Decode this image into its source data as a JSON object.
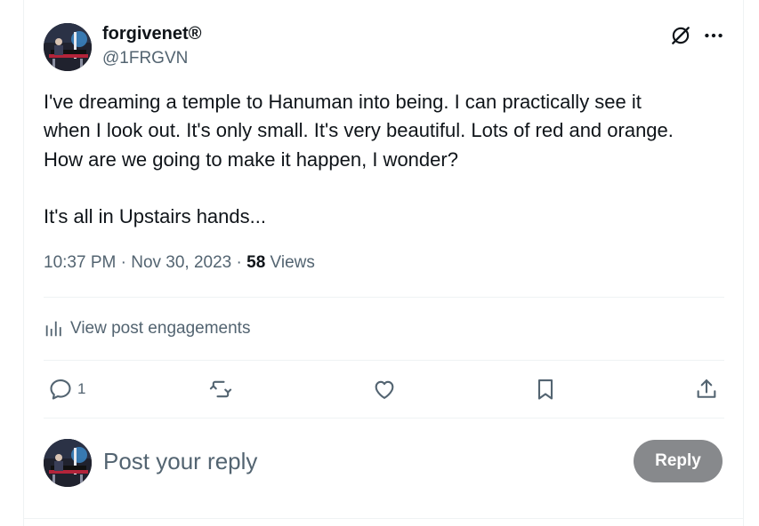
{
  "author": {
    "display_name": "forgivenet",
    "registered_mark": "®",
    "handle": "@1FRGVN",
    "avatar_icon": "avatar-pianist-icon"
  },
  "header_icons": {
    "grok": "grok-icon",
    "more": "more-icon"
  },
  "post": {
    "text": "I've dreaming a temple to Hanuman into being. I can practically see it\nwhen I look out. It's only small. It's very beautiful. Lots of red and orange.\nHow are we going to make it happen, I wonder?\n\nIt's all in Upstairs hands..."
  },
  "meta": {
    "time": "10:37 PM",
    "separator": " · ",
    "date": "Nov 30, 2023",
    "views_count": "58",
    "views_label": " Views"
  },
  "engagements": {
    "label": "View post engagements",
    "icon": "analytics-icon"
  },
  "actions": {
    "reply_count": "1",
    "reply_icon": "reply-icon",
    "repost_icon": "repost-icon",
    "like_icon": "like-icon",
    "bookmark_icon": "bookmark-icon",
    "share_icon": "share-icon"
  },
  "composer": {
    "placeholder": "Post your reply",
    "button_label": "Reply",
    "button_color": "#87898c"
  },
  "colors": {
    "text_primary": "#0f1419",
    "text_secondary": "#536471",
    "divider": "#eff3f4"
  }
}
